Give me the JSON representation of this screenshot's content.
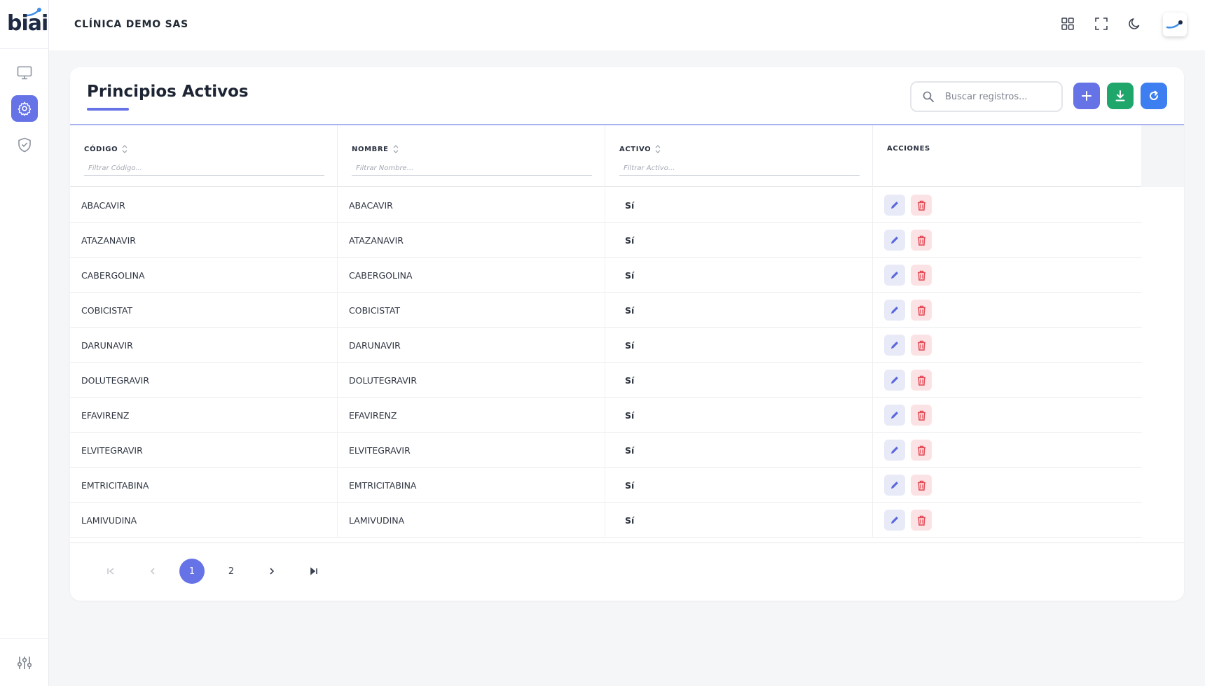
{
  "brand": {
    "logo_text": "biai",
    "accent": "#6673e6"
  },
  "header": {
    "company_name": "CLÍNICA DEMO SAS"
  },
  "page": {
    "title": "Principios Activos"
  },
  "toolbar": {
    "search_placeholder": "Buscar registros...",
    "add_icon": "plus-icon",
    "download_icon": "download-icon",
    "refresh_icon": "refresh-icon",
    "add_color": "#6673e6",
    "download_color": "#1fa66b",
    "refresh_color": "#3d7ef0"
  },
  "table": {
    "columns": [
      {
        "label": "CÓDIGO",
        "filter_placeholder": "Filtrar Código..."
      },
      {
        "label": "NOMBRE",
        "filter_placeholder": "Filtrar Nombre..."
      },
      {
        "label": "ACTIVO",
        "filter_placeholder": "Filtrar Activo..."
      },
      {
        "label": "ACCIONES"
      }
    ],
    "rows": [
      {
        "codigo": "ABACAVIR",
        "nombre": "ABACAVIR",
        "activo": "Sí"
      },
      {
        "codigo": "ATAZANAVIR",
        "nombre": "ATAZANAVIR",
        "activo": "Sí"
      },
      {
        "codigo": "CABERGOLINA",
        "nombre": "CABERGOLINA",
        "activo": "Sí"
      },
      {
        "codigo": "COBICISTAT",
        "nombre": "COBICISTAT",
        "activo": "Sí"
      },
      {
        "codigo": "DARUNAVIR",
        "nombre": "DARUNAVIR",
        "activo": "Sí"
      },
      {
        "codigo": "DOLUTEGRAVIR",
        "nombre": "DOLUTEGRAVIR",
        "activo": "Sí"
      },
      {
        "codigo": "EFAVIRENZ",
        "nombre": "EFAVIRENZ",
        "activo": "Sí"
      },
      {
        "codigo": "ELVITEGRAVIR",
        "nombre": "ELVITEGRAVIR",
        "activo": "Sí"
      },
      {
        "codigo": "EMTRICITABINA",
        "nombre": "EMTRICITABINA",
        "activo": "Sí"
      },
      {
        "codigo": "LAMIVUDINA",
        "nombre": "LAMIVUDINA",
        "activo": "Sí"
      }
    ]
  },
  "pagination": {
    "pages": [
      "1",
      "2"
    ],
    "current": "1"
  }
}
